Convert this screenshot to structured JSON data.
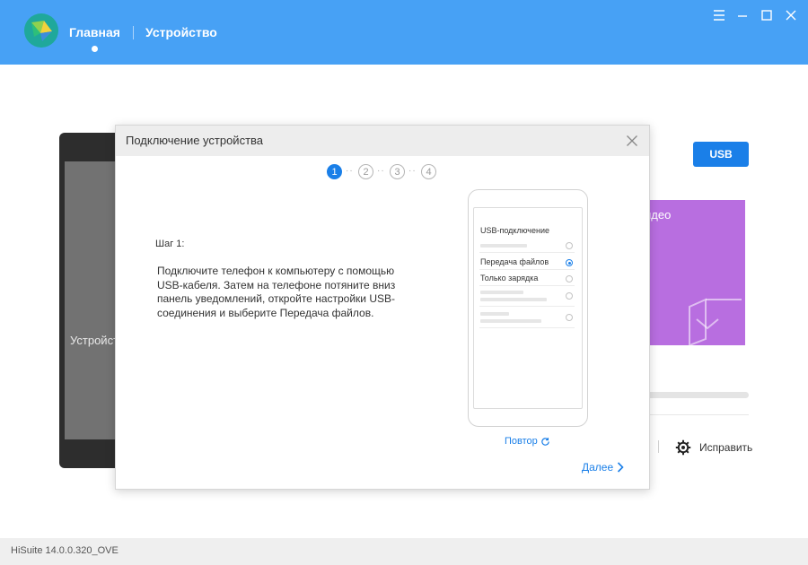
{
  "header": {
    "nav_home": "Главная",
    "nav_device": "Устройство"
  },
  "background": {
    "device_label": "Устройство",
    "usb_button": "USB",
    "card_text": "идео",
    "fix_label": "Исправить"
  },
  "dialog": {
    "title": "Подключение устройства",
    "steps": [
      "1",
      "2",
      "3",
      "4"
    ],
    "active_step": 1,
    "step_label": "Шаг 1:",
    "instruction": "Подключите телефон к компьютеру с помощью USB-кабеля. Затем на телефоне потяните вниз панель уведомлений, откройте настройки USB-соединения и выберите Передача файлов.",
    "phone": {
      "title": "USB-подключение",
      "option_files": "Передача файлов",
      "option_charge": "Только зарядка",
      "selected": "Передача файлов"
    },
    "retry": "Повтор",
    "next": "Далее"
  },
  "status": {
    "version": "HiSuite 14.0.0.320_OVE"
  },
  "colors": {
    "header_blue": "#47a1f5",
    "accent": "#1a7fe8",
    "card_purple": "#b86ee0"
  }
}
